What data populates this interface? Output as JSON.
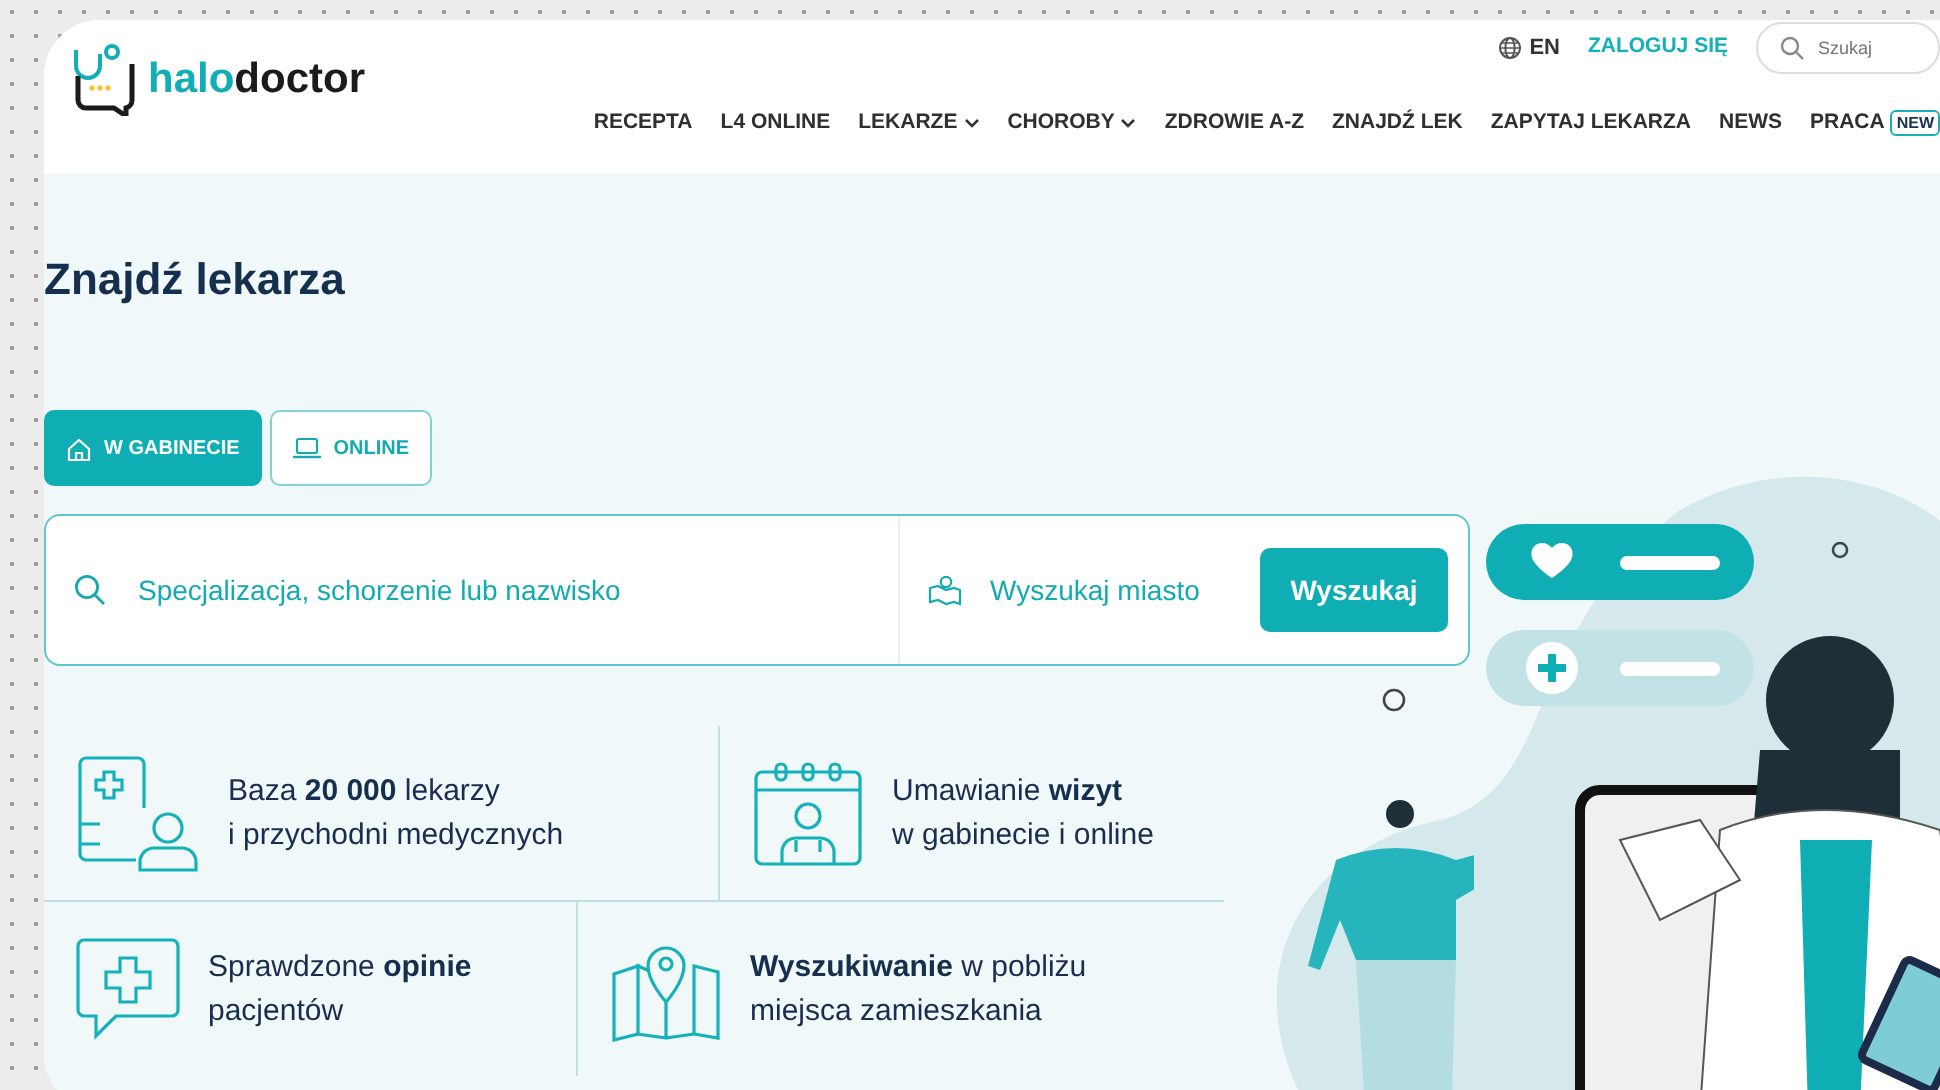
{
  "header": {
    "logo": {
      "part1": "halo",
      "part2": "doctor"
    },
    "language": "EN",
    "login": "ZALOGUJ SIĘ",
    "search": {
      "placeholder": "Szukaj"
    },
    "nav": [
      {
        "label": "RECEPTA",
        "dropdown": false
      },
      {
        "label": "L4 ONLINE",
        "dropdown": false
      },
      {
        "label": "LEKARZE",
        "dropdown": true
      },
      {
        "label": "CHOROBY",
        "dropdown": true
      },
      {
        "label": "ZDROWIE A-Z",
        "dropdown": false
      },
      {
        "label": "ZNAJDŹ LEK",
        "dropdown": false
      },
      {
        "label": "ZAPYTAJ LEKARZA",
        "dropdown": false
      },
      {
        "label": "NEWS",
        "dropdown": false
      },
      {
        "label": "PRACA",
        "dropdown": false,
        "badge": "NEW"
      }
    ]
  },
  "title": "Znajdź lekarza",
  "tabs": [
    {
      "label": "W GABINECIE",
      "kind": "home",
      "selected": true
    },
    {
      "label": "ONLINE",
      "kind": "laptop",
      "selected": false
    }
  ],
  "search": {
    "query": {
      "placeholder": "Specjalizacja, schorzenie lub nazwisko"
    },
    "city": {
      "placeholder": "Wyszukaj miasto"
    },
    "button": "Wyszukaj"
  },
  "features": [
    {
      "kind": "doctors",
      "lines": [
        "Baza **20 000** lekarzy",
        "i przychodni medycznych"
      ]
    },
    {
      "kind": "calendar",
      "lines": [
        "Umawianie **wizyt**",
        "w gabinecie i online"
      ]
    },
    {
      "kind": "opinions",
      "lines": [
        "Sprawdzone **opinie**",
        "pacjentów"
      ]
    },
    {
      "kind": "map",
      "lines": [
        "**Wyszukiwanie** w pobliżu",
        "miejsca zamieszkania"
      ]
    }
  ]
}
